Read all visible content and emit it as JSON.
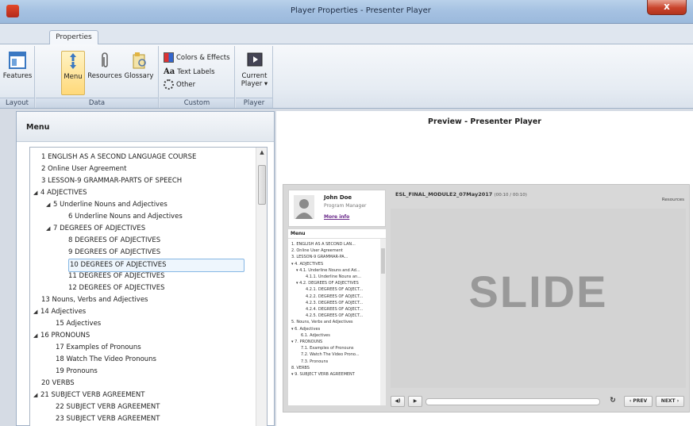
{
  "window": {
    "title": "Player Properties - Presenter Player",
    "close_label": "x"
  },
  "ribbon": {
    "tab": "Properties",
    "groups": {
      "layout": {
        "label": "Layout",
        "features": "Features"
      },
      "data": {
        "label": "Data",
        "menu": "Menu",
        "resources": "Resources",
        "glossary": "Glossary"
      },
      "custom": {
        "label": "Custom",
        "colors": "Colors & Effects",
        "text_labels": "Text Labels",
        "other": "Other"
      },
      "player": {
        "label": "Player",
        "current_1": "Current",
        "current_2": "Player ▾"
      }
    }
  },
  "left": {
    "title": "Menu",
    "tree": [
      {
        "label": "1 ENGLISH AS A SECOND LANGUAGE COURSE",
        "level": 0,
        "toggle": ""
      },
      {
        "label": "2 Online User Agreement",
        "level": 0,
        "toggle": ""
      },
      {
        "label": "3 LESSON-9     GRAMMAR-PARTS OF SPEECH",
        "level": 0,
        "toggle": ""
      },
      {
        "label": "4 ADJECTIVES",
        "level": 0,
        "toggle": "◢"
      },
      {
        "label": "5 Underline Nouns and Adjectives",
        "level": 1,
        "toggle": "◢"
      },
      {
        "label": "6 Underline Nouns and Adjectives",
        "level": 2,
        "toggle": ""
      },
      {
        "label": "7 DEGREES OF ADJECTIVES",
        "level": 1,
        "toggle": "◢"
      },
      {
        "label": "8 DEGREES OF ADJECTIVES",
        "level": 2,
        "toggle": ""
      },
      {
        "label": "9 DEGREES OF ADJECTIVES",
        "level": 2,
        "toggle": ""
      },
      {
        "label": "10 DEGREES OF ADJECTIVES",
        "level": 2,
        "toggle": "",
        "selected": true
      },
      {
        "label": "11 DEGREES OF ADJECTIVES",
        "level": 2,
        "toggle": ""
      },
      {
        "label": "12 DEGREES OF ADJECTIVES",
        "level": 2,
        "toggle": ""
      },
      {
        "label": "13 Nouns, Verbs and Adjectives",
        "level": 0,
        "toggle": ""
      },
      {
        "label": "14 Adjectives",
        "level": 0,
        "toggle": "◢"
      },
      {
        "label": "15 Adjectives",
        "level": 1,
        "toggle": ""
      },
      {
        "label": "16 PRONOUNS",
        "level": 0,
        "toggle": "◢"
      },
      {
        "label": "17 Examples of Pronouns",
        "level": 1,
        "toggle": ""
      },
      {
        "label": "18 Watch The Video  Pronouns",
        "level": 1,
        "toggle": ""
      },
      {
        "label": "19 Pronouns",
        "level": 1,
        "toggle": ""
      },
      {
        "label": "20 VERBS",
        "level": 0,
        "toggle": ""
      },
      {
        "label": "21 SUBJECT VERB AGREEMENT",
        "level": 0,
        "toggle": "◢"
      },
      {
        "label": "22 SUBJECT VERB AGREEMENT",
        "level": 1,
        "toggle": ""
      },
      {
        "label": "23 SUBJECT VERB AGREEMENT",
        "level": 1,
        "toggle": ""
      }
    ]
  },
  "preview": {
    "title": "Preview - Presenter Player",
    "profile": {
      "name": "John Doe",
      "role": "Program Manager",
      "more": "More info"
    },
    "menu_label": "Menu",
    "menu_items": [
      "1. ENGLISH AS A SECOND LAN...",
      "2. Online User Agreement",
      "3. LESSON-9      GRAMMAR-PA...",
      "▾ 4. ADJECTIVES",
      "  ▾ 4.1. Underline Nouns and Ad...",
      "      4.1.1. Underline Nouns an...",
      "  ▾ 4.2. DEGREES OF ADJECTIVES",
      "      4.2.1. DEGREES OF ADJECT...",
      "      4.2.2. DEGREES OF ADJECT...",
      "      4.2.3. DEGREES OF ADJECT...",
      "      4.2.4. DEGREES OF ADJECT...",
      "      4.2.5. DEGREES OF ADJECT...",
      "5. Nouns, Verbs and Adjectives",
      "▾ 6. Adjectives",
      "    6.1. Adjectives",
      "▾ 7. PRONOUNS",
      "    7.1. Examples of Pronouns",
      "    7.2. Watch The Video  Prono...",
      "    7.3. Pronouns",
      "8. VERBS",
      "▾ 9. SUBJECT VERB AGREEMENT"
    ],
    "slide_title": "ESL_FINAL_MODULE2_07May2017",
    "slide_time": "(00:10 / 00:10)",
    "resources": "Resources",
    "slide_text": "SLIDE",
    "prev": "‹ PREV",
    "next": "NEXT ›",
    "volume_icon": "◀)",
    "play_icon": "▶",
    "replay_icon": "↻"
  }
}
